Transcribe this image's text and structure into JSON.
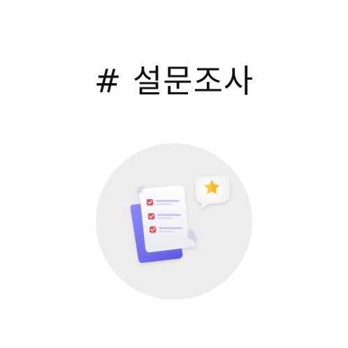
{
  "title": "# 설문조사",
  "icon": {
    "name": "survey-checklist-icon",
    "badge": "star-speech-bubble-icon"
  },
  "colors": {
    "background": "#ffffff",
    "circle": "#ededed",
    "accent_blue": "#6e6cf0",
    "check_red": "#e8505b",
    "star_yellow": "#ffc83d"
  }
}
